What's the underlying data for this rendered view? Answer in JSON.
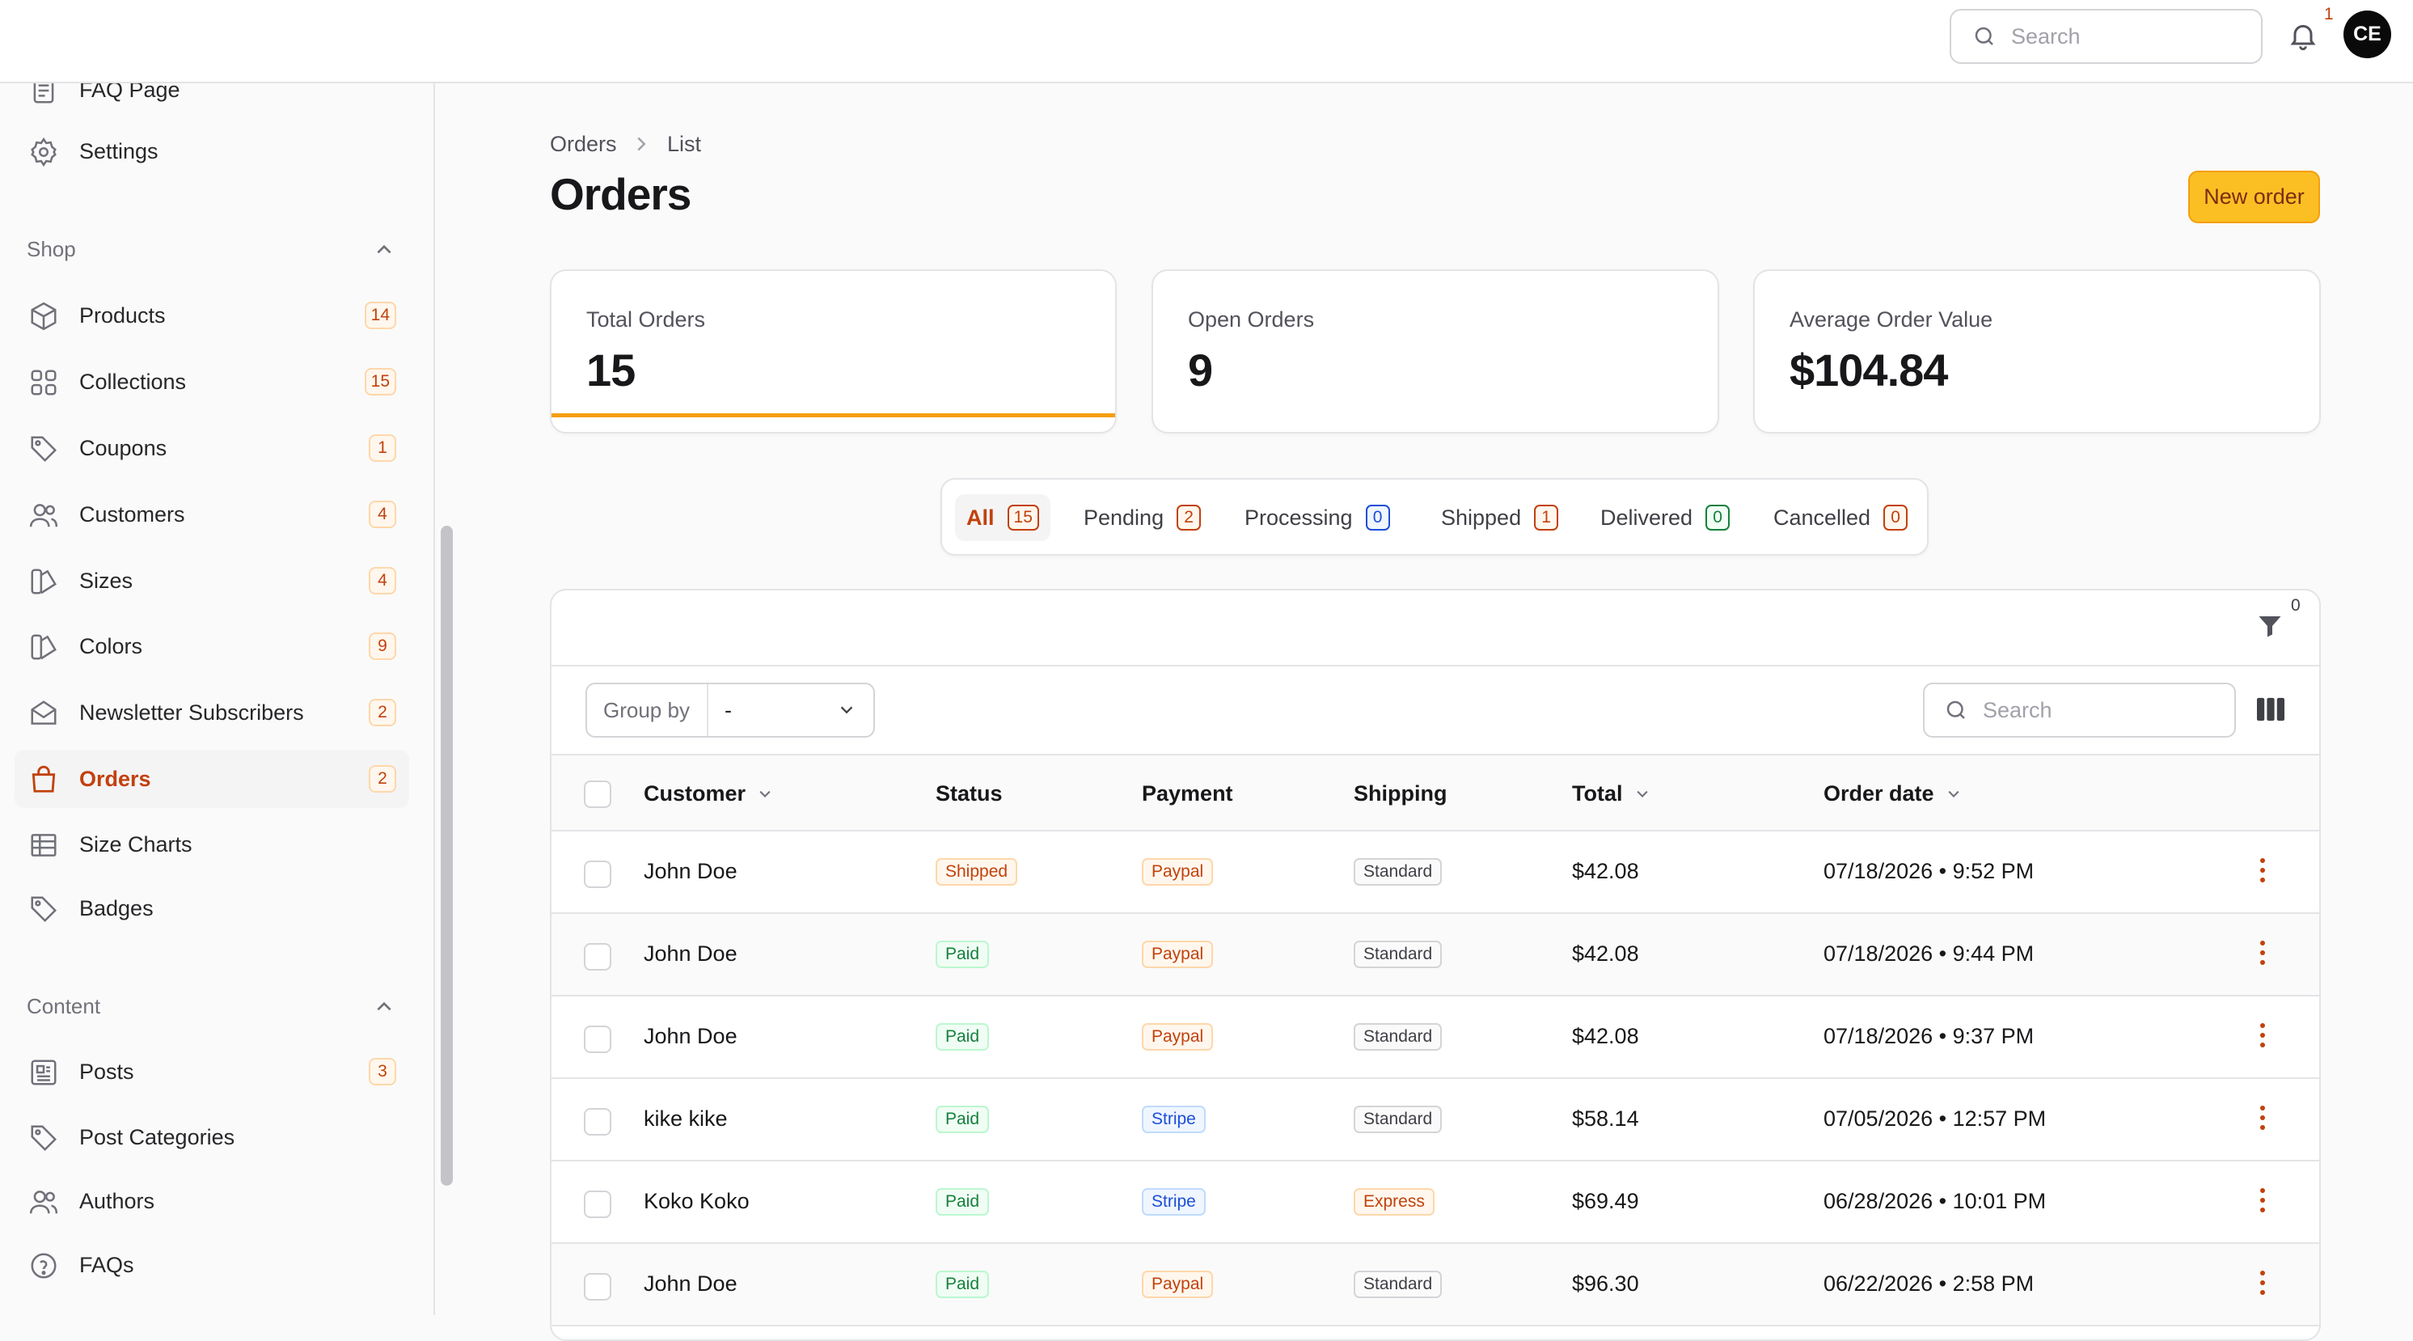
{
  "topbar": {
    "search_placeholder": "Search",
    "notification_count": "1",
    "avatar_initials": "CE"
  },
  "sidebar": {
    "top_items": [
      {
        "label": "FAQ Page",
        "icon": "document-icon"
      },
      {
        "label": "Settings",
        "icon": "gear-icon"
      }
    ],
    "shop_title": "Shop",
    "shop_items": [
      {
        "label": "Products",
        "count": "14",
        "icon": "cube-icon"
      },
      {
        "label": "Collections",
        "count": "15",
        "icon": "grid-icon"
      },
      {
        "label": "Coupons",
        "count": "1",
        "icon": "tag-icon"
      },
      {
        "label": "Customers",
        "count": "4",
        "icon": "users-icon"
      },
      {
        "label": "Sizes",
        "count": "4",
        "icon": "swatch-icon"
      },
      {
        "label": "Colors",
        "count": "9",
        "icon": "swatch-icon"
      },
      {
        "label": "Newsletter Subscribers",
        "count": "2",
        "icon": "envelope-icon"
      },
      {
        "label": "Orders",
        "count": "2",
        "icon": "shopping-bag-icon",
        "active": true
      },
      {
        "label": "Size Charts",
        "count": "",
        "icon": "table-icon"
      },
      {
        "label": "Badges",
        "count": "",
        "icon": "tag-icon"
      }
    ],
    "content_title": "Content",
    "content_items": [
      {
        "label": "Posts",
        "count": "3",
        "icon": "newspaper-icon"
      },
      {
        "label": "Post Categories",
        "count": "",
        "icon": "tag-icon"
      },
      {
        "label": "Authors",
        "count": "",
        "icon": "users-icon"
      },
      {
        "label": "FAQs",
        "count": "",
        "icon": "question-icon"
      }
    ]
  },
  "breadcrumb": {
    "root": "Orders",
    "current": "List"
  },
  "page": {
    "title": "Orders",
    "new_order_label": "New order"
  },
  "stats": [
    {
      "label": "Total Orders",
      "value": "15"
    },
    {
      "label": "Open Orders",
      "value": "9"
    },
    {
      "label": "Average Order Value",
      "value": "$104.84"
    }
  ],
  "tabs": [
    {
      "label": "All",
      "count": "15",
      "active": true,
      "color": "orange"
    },
    {
      "label": "Pending",
      "count": "2",
      "color": "orange"
    },
    {
      "label": "Processing",
      "count": "0",
      "color": "blue"
    },
    {
      "label": "Shipped",
      "count": "1",
      "color": "orange"
    },
    {
      "label": "Delivered",
      "count": "0",
      "color": "green"
    },
    {
      "label": "Cancelled",
      "count": "0",
      "color": "orange"
    }
  ],
  "table": {
    "filter_count": "0",
    "group_by_label": "Group by",
    "group_by_value": "-",
    "search_placeholder": "Search",
    "columns": [
      "Customer",
      "Status",
      "Payment",
      "Shipping",
      "Total",
      "Order date"
    ],
    "rows": [
      {
        "customer": "John Doe",
        "status": "Shipped",
        "status_color": "orange",
        "payment": "Paypal",
        "payment_color": "orange",
        "shipping": "Standard",
        "shipping_color": "gray",
        "total": "$42.08",
        "date": "07/18/2026 • 9:52 PM"
      },
      {
        "customer": "John Doe",
        "status": "Paid",
        "status_color": "green",
        "payment": "Paypal",
        "payment_color": "orange",
        "shipping": "Standard",
        "shipping_color": "gray",
        "total": "$42.08",
        "date": "07/18/2026 • 9:44 PM"
      },
      {
        "customer": "John Doe",
        "status": "Paid",
        "status_color": "green",
        "payment": "Paypal",
        "payment_color": "orange",
        "shipping": "Standard",
        "shipping_color": "gray",
        "total": "$42.08",
        "date": "07/18/2026 • 9:37 PM"
      },
      {
        "customer": "kike kike",
        "status": "Paid",
        "status_color": "green",
        "payment": "Stripe",
        "payment_color": "blue",
        "shipping": "Standard",
        "shipping_color": "gray",
        "total": "$58.14",
        "date": "07/05/2026 • 12:57 PM"
      },
      {
        "customer": "Koko Koko",
        "status": "Paid",
        "status_color": "green",
        "payment": "Stripe",
        "payment_color": "blue",
        "shipping": "Express",
        "shipping_color": "orange",
        "total": "$69.49",
        "date": "06/28/2026 • 10:01 PM"
      },
      {
        "customer": "John Doe",
        "status": "Paid",
        "status_color": "green",
        "payment": "Paypal",
        "payment_color": "orange",
        "shipping": "Standard",
        "shipping_color": "gray",
        "total": "$96.30",
        "date": "06/22/2026 • 2:58 PM"
      }
    ]
  },
  "colors": {
    "accent": "#f59e0b",
    "active_text": "#c2410c"
  }
}
